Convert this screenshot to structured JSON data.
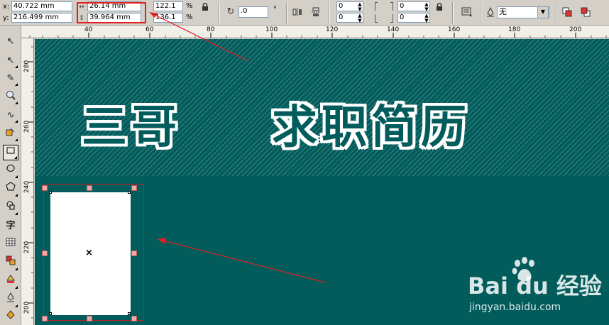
{
  "propbar": {
    "x_label": "x:",
    "x_value": "40.722 mm",
    "y_label": "y:",
    "y_value": "216.499 mm",
    "width_value": "26.14 mm",
    "height_value": "39.964 mm",
    "scale_x": "122.1",
    "scale_y": "136.1",
    "percent": "%",
    "rotation": ".0",
    "degree": "°",
    "corner_tl": "0",
    "corner_bl": "0",
    "corner_tr": "0",
    "corner_br": "0",
    "outline_width": "无"
  },
  "ruler": {
    "h_ticks": [
      "40",
      "60",
      "80",
      "100",
      "120",
      "140",
      "160",
      "180",
      "200"
    ],
    "v_ticks": [
      "280",
      "260",
      "240",
      "220",
      "200"
    ]
  },
  "canvas": {
    "title_left": "三哥",
    "title_right": "求职简历"
  },
  "watermark": {
    "logo": "Bai du 经验",
    "url": "jingyan.baidu.com"
  },
  "colors": {
    "teal": "#035c5c",
    "highlight": "#e02020",
    "handle": "#f5aaaa"
  }
}
